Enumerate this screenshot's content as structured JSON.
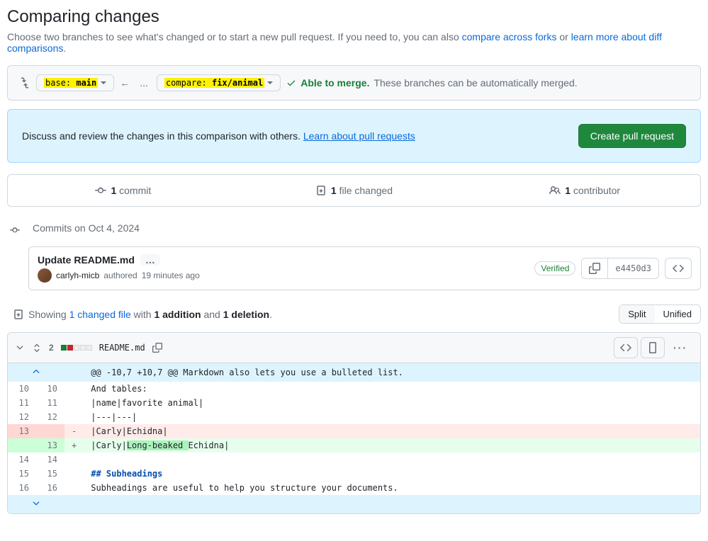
{
  "page": {
    "title": "Comparing changes",
    "subtitle_pre": "Choose two branches to see what's changed or to start a new pull request. If you need to, you can also ",
    "link_compare_forks": "compare across forks",
    "subtitle_or": " or ",
    "link_learn_diff": "learn more about diff comparisons",
    "subtitle_end": "."
  },
  "compare": {
    "base_prefix": "base: ",
    "base_branch": "main",
    "compare_prefix": "compare: ",
    "compare_branch": "fix/animal",
    "merge_ok": "Able to merge.",
    "merge_rest": "These branches can be automatically merged."
  },
  "discuss": {
    "text_pre": "Discuss and review the changes in this comparison with others. ",
    "link": "Learn about pull requests",
    "button": "Create pull request"
  },
  "summary": {
    "commits_n": "1",
    "commits_label": " commit",
    "files_n": "1",
    "files_label": " file changed",
    "contrib_n": "1",
    "contrib_label": " contributor"
  },
  "commits": {
    "header": "Commits on Oct 4, 2024",
    "items": [
      {
        "title": "Update README.md",
        "author": "carlyh-micb",
        "authored": " authored ",
        "time": "19 minutes ago",
        "verified": "Verified",
        "sha": "e4450d3"
      }
    ]
  },
  "changes": {
    "showing": "Showing ",
    "link_files": "1 changed file",
    "with": " with ",
    "additions": "1 addition",
    "and": " and ",
    "deletions": "1 deletion",
    "end": ".",
    "split": "Split",
    "unified": "Unified"
  },
  "diff": {
    "stat_num": "2",
    "filename": "README.md",
    "hunk": "@@ -10,7 +10,7 @@ Markdown also lets you use a bulleted list.",
    "rows": [
      {
        "l": "10",
        "r": "10",
        "sign": " ",
        "text": "And tables:"
      },
      {
        "l": "11",
        "r": "11",
        "sign": " ",
        "text": "|name|favorite animal|"
      },
      {
        "l": "12",
        "r": "12",
        "sign": " ",
        "text": "|---|---|"
      },
      {
        "l": "13",
        "r": "",
        "sign": "-",
        "text_pre": "|Carly|",
        "text_hl": "",
        "text_mid": "Echidna|",
        "cls": "del"
      },
      {
        "l": "",
        "r": "13",
        "sign": "+",
        "text_pre": "|Carly|",
        "text_hl": "Long-beaked ",
        "text_mid": "Echidna|",
        "cls": "add"
      },
      {
        "l": "14",
        "r": "14",
        "sign": " ",
        "text": ""
      },
      {
        "l": "15",
        "r": "15",
        "sign": " ",
        "sub": "## Subheadings"
      },
      {
        "l": "16",
        "r": "16",
        "sign": " ",
        "text": "Subheadings are useful to help you structure your documents."
      }
    ]
  }
}
